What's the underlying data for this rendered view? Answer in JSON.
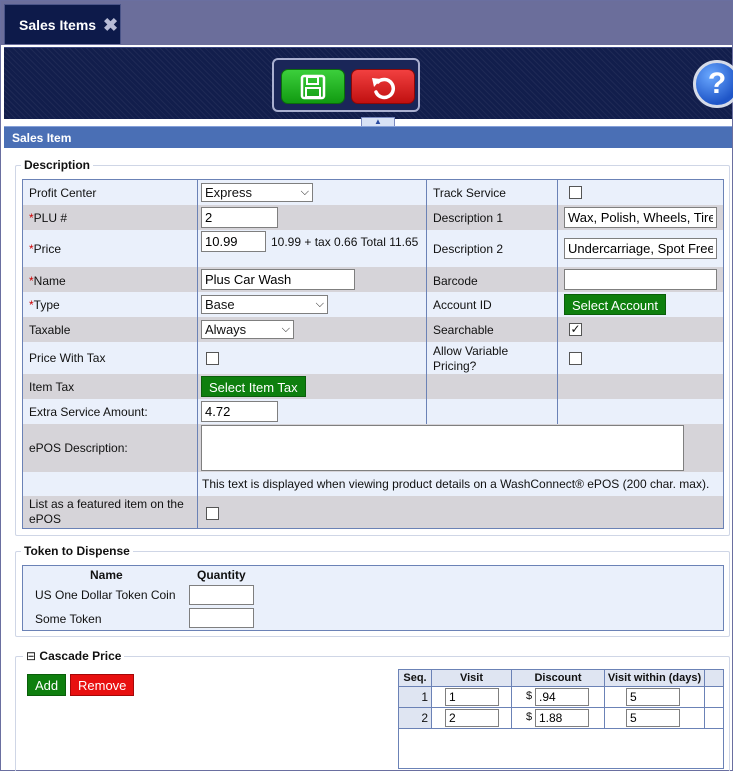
{
  "tab": {
    "title": "Sales Items",
    "close_glyph": "✖"
  },
  "toolbar": {
    "help_glyph": "?",
    "collapse_glyph": "▲"
  },
  "section": {
    "title": "Sales Item"
  },
  "description": {
    "legend": "Description",
    "profit_center": {
      "label": "Profit Center",
      "value": "Express"
    },
    "plu": {
      "label": "PLU #",
      "value": "2"
    },
    "price": {
      "label": "Price",
      "value": "10.99",
      "summary": "10.99 + tax 0.66 Total 11.65"
    },
    "name": {
      "label": "Name",
      "value": "Plus Car Wash"
    },
    "type": {
      "label": "Type",
      "value": "Base"
    },
    "taxable": {
      "label": "Taxable",
      "value": "Always"
    },
    "price_with_tax": {
      "label": "Price With Tax",
      "checked": false
    },
    "item_tax": {
      "label": "Item Tax",
      "button": "Select Item Tax"
    },
    "extra_service": {
      "label": "Extra Service Amount:",
      "value": "4.72"
    },
    "epos_description": {
      "label": "ePOS Description:",
      "value": "",
      "help": "This text is displayed when viewing product details on a WashConnect® ePOS (200 char. max)."
    },
    "featured": {
      "label_line1": "List as a featured item on the",
      "label_line2": "ePOS",
      "checked": false
    },
    "track_service": {
      "label": "Track Service",
      "checked": false
    },
    "description1": {
      "label": "Description 1",
      "value": "Wax, Polish, Wheels, Tire"
    },
    "description2": {
      "label": "Description 2",
      "value": "Undercarriage, Spot Free"
    },
    "barcode": {
      "label": "Barcode",
      "value": ""
    },
    "account_id": {
      "label": "Account ID",
      "button": "Select Account"
    },
    "searchable": {
      "label": "Searchable",
      "checked": true
    },
    "allow_variable": {
      "label_line1": "Allow Variable",
      "label_line2": "Pricing?",
      "checked": false
    },
    "required_mark": "*"
  },
  "token": {
    "legend": "Token to Dispense",
    "col_name": "Name",
    "col_qty": "Quantity",
    "rows": [
      {
        "name": "US One Dollar Token Coin",
        "qty": ""
      },
      {
        "name": "Some Token",
        "qty": ""
      }
    ]
  },
  "cascade": {
    "legend": "Cascade Price",
    "toggle": "⊟",
    "add": "Add",
    "remove": "Remove",
    "headers": {
      "seq": "Seq.",
      "visit": "Visit",
      "discount": "Discount",
      "within": "Visit within (days)"
    },
    "currency": "$",
    "rows": [
      {
        "seq": "1",
        "visit": "1",
        "discount": ".94",
        "within": "5"
      },
      {
        "seq": "2",
        "visit": "2",
        "discount": "1.88",
        "within": "5"
      }
    ]
  }
}
